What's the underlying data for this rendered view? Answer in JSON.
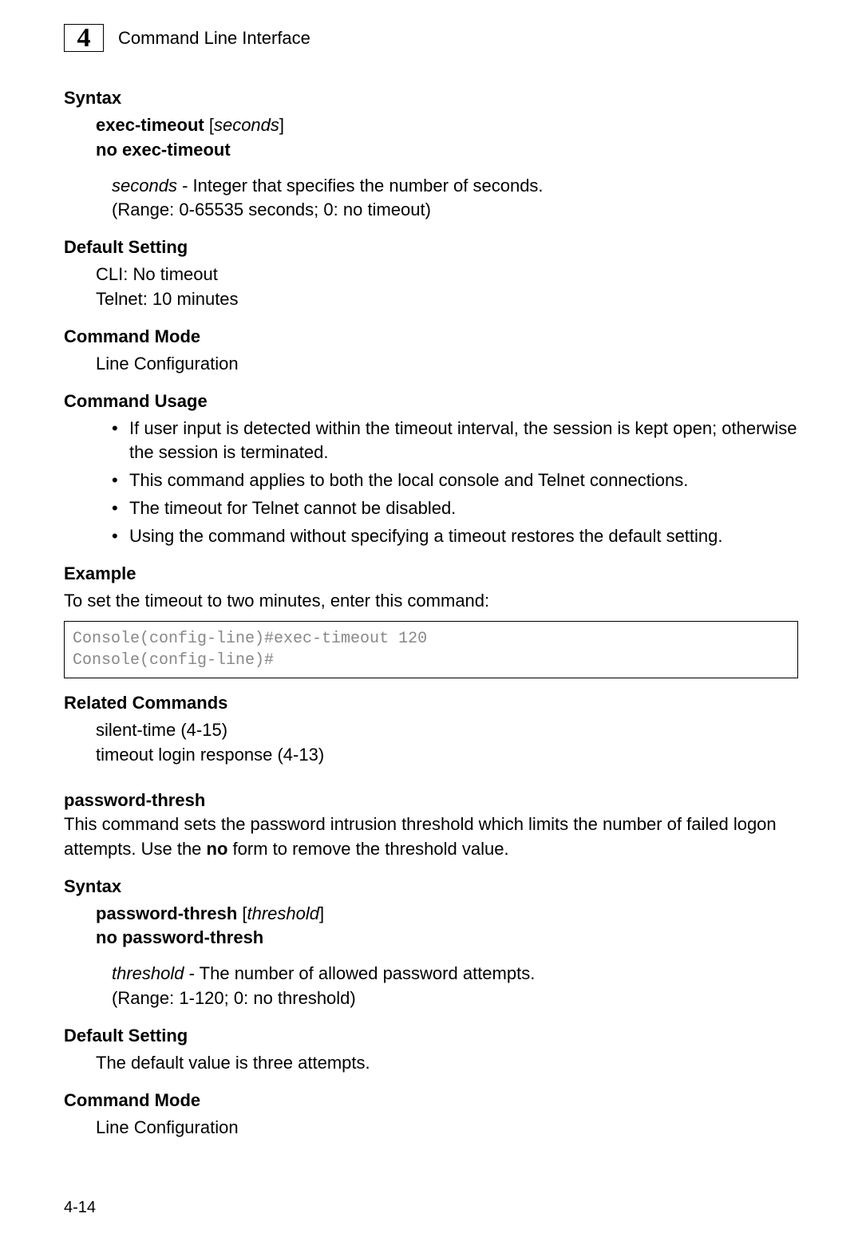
{
  "header": {
    "chapterNumber": "4",
    "title": "Command Line Interface"
  },
  "s1": {
    "syntaxHeading": "Syntax",
    "syntaxCmd1_bold": "exec-timeout",
    "syntaxCmd1_bracket_open": " [",
    "syntaxCmd1_italic": "seconds",
    "syntaxCmd1_bracket_close": "]",
    "syntaxCmd2": "no exec-timeout",
    "param_italic": "seconds",
    "param_desc": " - Integer that specifies the number of seconds.",
    "param_range": "(Range: 0-65535 seconds; 0: no timeout)",
    "defaultSettingHeading": "Default Setting",
    "default1": "CLI: No timeout",
    "default2": "Telnet: 10 minutes",
    "commandModeHeading": "Command Mode",
    "commandMode": "Line Configuration",
    "commandUsageHeading": "Command Usage",
    "usage1": "If user input is detected within the timeout interval, the session is kept open; otherwise the session is terminated.",
    "usage2": "This command applies to both the local console and Telnet connections.",
    "usage3": "The timeout for Telnet cannot be disabled.",
    "usage4": "Using the command without specifying a timeout restores the default setting.",
    "exampleHeading": "Example",
    "exampleDesc": "To set the timeout to two minutes, enter this command:",
    "code": "Console(config-line)#exec-timeout 120\nConsole(config-line)#",
    "relatedHeading": "Related Commands",
    "related1": "silent-time (4-15)",
    "related2": "timeout login response (4-13)"
  },
  "s2": {
    "title": "password-thresh",
    "desc1": "This command sets the password intrusion threshold which limits the number of failed logon attempts. Use the ",
    "desc_bold": "no",
    "desc2": " form to remove the threshold value.",
    "syntaxHeading": "Syntax",
    "syntaxCmd1_bold": "password-thresh",
    "syntaxCmd1_bracket_open": " [",
    "syntaxCmd1_italic": "threshold",
    "syntaxCmd1_bracket_close": "]",
    "syntaxCmd2": "no password-thresh",
    "param_italic": "threshold",
    "param_desc": " - The number of allowed password attempts.",
    "param_range": "(Range: 1-120; 0: no threshold)",
    "defaultSettingHeading": "Default Setting",
    "default1": "The default value is three attempts.",
    "commandModeHeading": "Command Mode",
    "commandMode": "Line Configuration"
  },
  "pageNumber": "4-14"
}
